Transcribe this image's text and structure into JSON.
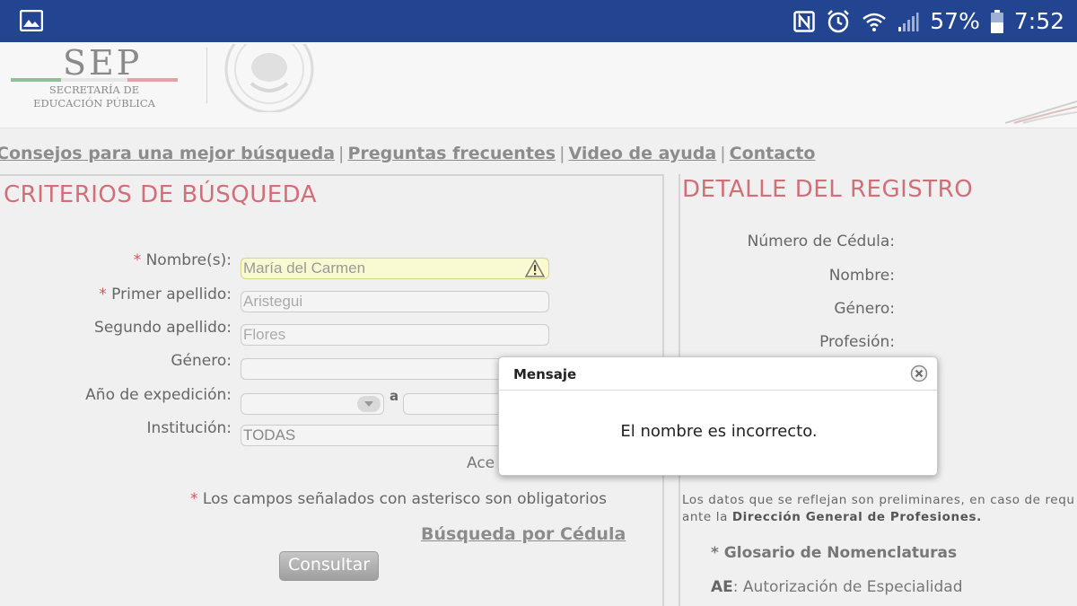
{
  "status_bar": {
    "battery": "57%",
    "time": "7:52",
    "icons": [
      "gallery-icon",
      "nfc-icon",
      "alarm-icon",
      "wifi-icon",
      "signal-icon",
      "battery-icon"
    ]
  },
  "header": {
    "logo_text": "SEP",
    "logo_subtitle": "SECRETARÍA DE EDUCACIÓN PÚBLICA"
  },
  "links": [
    "Consejos para una mejor búsqueda",
    "Preguntas frecuentes",
    "Video de ayuda",
    "Contacto"
  ],
  "link_separator": "|",
  "criteria": {
    "title": "CRITERIOS DE BÚSQUEDA",
    "required_mark": "*",
    "nombre_label": "Nombre(s):",
    "nombre_value": "María del Carmen",
    "primer_apellido_label": "Primer apellido:",
    "primer_apellido_value": "Aristegui",
    "segundo_apellido_label": "Segundo apellido:",
    "segundo_apellido_value": "Flores",
    "genero_label": "Género:",
    "genero_value": "",
    "anio_label": "Año de expedición:",
    "anio_connector": "a",
    "institucion_label": "Institución:",
    "institucion_value": "TODAS",
    "accept_text": "Ace",
    "required_note": "Los campos señalados con asterisco son obligatorios",
    "cedula_link": "Búsqueda por Cédula",
    "consultar_button": "Consultar"
  },
  "detail": {
    "title": "DETALLE DEL REGISTRO",
    "labels": [
      "Número de Cédula:",
      "Nombre:",
      "Género:",
      "Profesión:"
    ],
    "disclaimer_line1": "Los datos que se reflejan son preliminares, en caso de requ",
    "disclaimer_line2_prefix": "ante la ",
    "disclaimer_line2_bold": "Dirección General de Profesiones.",
    "glosario": "* Glosario de Nomenclaturas",
    "ae_code": "AE",
    "ae_text": ": Autorización de Especialidad"
  },
  "modal": {
    "title": "Mensaje",
    "message": "El nombre es incorrecto."
  },
  "colors": {
    "status_bar": "#234591",
    "section_title": "#d16f79",
    "required": "#d8535e",
    "warning_field": "#fafad2"
  }
}
